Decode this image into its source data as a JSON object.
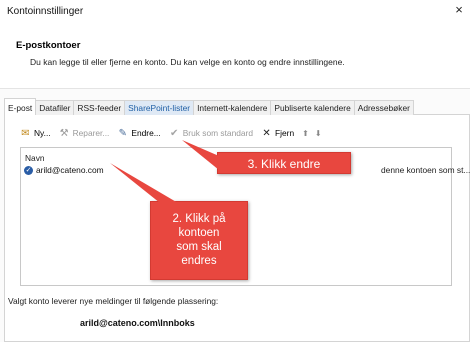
{
  "window": {
    "title": "Kontoinnstillinger",
    "close_glyph": "×"
  },
  "section": {
    "title": "E-postkontoer",
    "description": "Du kan legge til eller fjerne en konto. Du kan velge en konto og endre innstillingene."
  },
  "tabs": [
    {
      "label": "E-post",
      "active": true
    },
    {
      "label": "Datafiler"
    },
    {
      "label": "RSS-feeder"
    },
    {
      "label": "SharePoint-lister"
    },
    {
      "label": "Internett-kalendere"
    },
    {
      "label": "Publiserte kalendere"
    },
    {
      "label": "Adressebøker"
    }
  ],
  "toolbar": {
    "new_label": "Ny...",
    "repair_label": "Reparer...",
    "change_label": "Endre...",
    "default_label": "Bruk som standard",
    "remove_label": "Fjern",
    "up_glyph": "⬆",
    "down_glyph": "⬇"
  },
  "list": {
    "header": "Navn",
    "rows": [
      {
        "name": "arild@cateno.com",
        "type": "denne kontoen som st..."
      }
    ]
  },
  "callouts": {
    "step3": "3. Klikk endre",
    "step2_lines": [
      "2. Klikk på",
      "kontoen",
      "som skal",
      "endres"
    ]
  },
  "footer": {
    "deliver_text": "Valgt konto leverer nye meldinger til følgende plassering:",
    "deliver_path": "arild@cateno.com\\Innboks"
  }
}
